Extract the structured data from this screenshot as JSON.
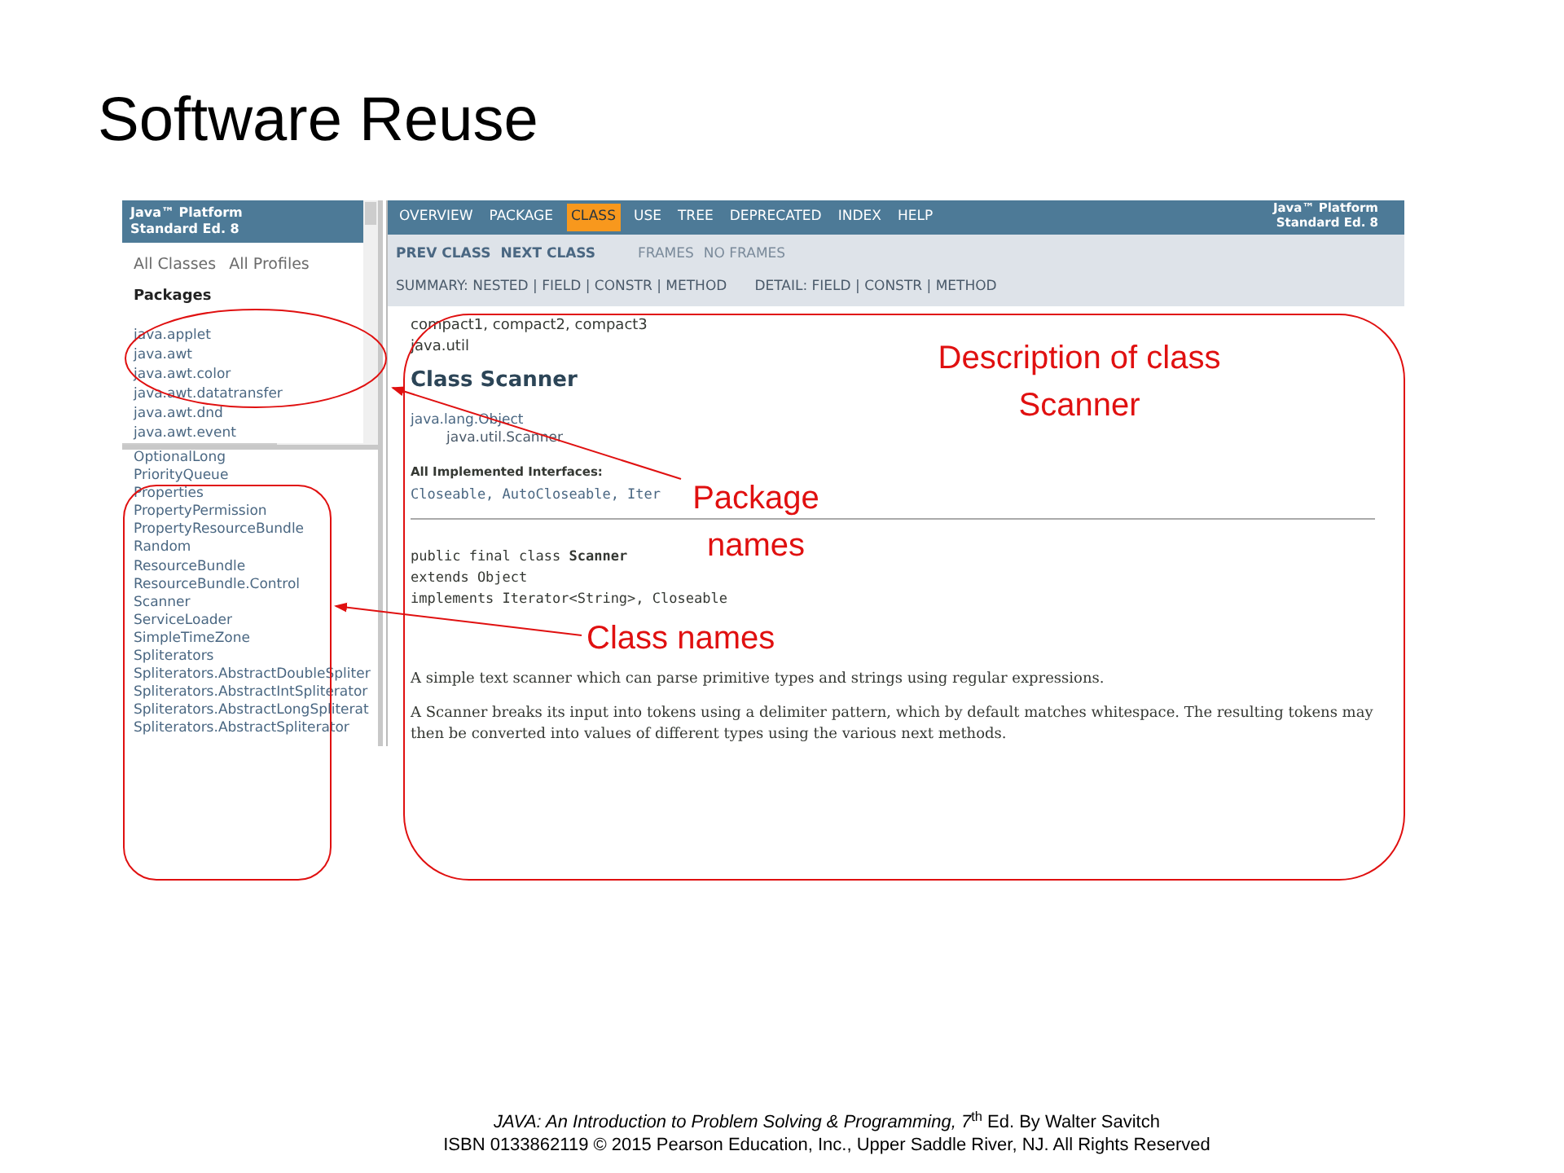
{
  "slide": {
    "title": "Software Reuse"
  },
  "left_frame": {
    "header_lines": [
      "Java™ Platform",
      "Standard Ed. 8"
    ],
    "links": [
      "All Classes",
      "All Profiles"
    ],
    "packages_heading": "Packages",
    "packages": [
      "java.applet",
      "java.awt",
      "java.awt.color",
      "java.awt.datatransfer",
      "java.awt.dnd",
      "java.awt.event"
    ]
  },
  "class_list": [
    "OptionalLong",
    "PriorityQueue",
    "Properties",
    "PropertyPermission",
    "PropertyResourceBundle",
    "Random",
    "ResourceBundle",
    "ResourceBundle.Control",
    "Scanner",
    "ServiceLoader",
    "SimpleTimeZone",
    "Spliterators",
    "Spliterators.AbstractDoubleSpliter",
    "Spliterators.AbstractIntSpliterator",
    "Spliterators.AbstractLongSpliterat",
    "Spliterators.AbstractSpliterator"
  ],
  "nav": {
    "items": [
      {
        "label": "OVERVIEW",
        "selected": false
      },
      {
        "label": "PACKAGE",
        "selected": false
      },
      {
        "label": "CLASS",
        "selected": true
      },
      {
        "label": "USE",
        "selected": false
      },
      {
        "label": "TREE",
        "selected": false
      },
      {
        "label": "DEPRECATED",
        "selected": false
      },
      {
        "label": "INDEX",
        "selected": false
      },
      {
        "label": "HELP",
        "selected": false
      }
    ],
    "header_lines": [
      "Java™ Platform",
      "Standard Ed. 8"
    ]
  },
  "subnav": {
    "prev": "PREV CLASS",
    "next": "NEXT CLASS",
    "frames": "FRAMES",
    "no_frames": "NO FRAMES",
    "summary": "SUMMARY: NESTED | FIELD | CONSTR | METHOD",
    "detail": "DETAIL: FIELD | CONSTR | METHOD"
  },
  "content": {
    "profiles": "compact1, compact2, compact3",
    "package": "java.util",
    "title": "Class Scanner",
    "hierarchy": [
      "java.lang.Object",
      "java.util.Scanner"
    ],
    "interfaces_heading": "All Implemented Interfaces:",
    "interfaces": "Closeable, AutoCloseable, Iter",
    "signature": [
      "public final class **Scanner**",
      "extends Object",
      "implements Iterator<String>, Closeable"
    ],
    "description": [
      "A simple text scanner which can parse primitive types and strings using regular expressions.",
      "A Scanner breaks its input into tokens using a delimiter pattern, which by default matches whitespace. The resulting tokens may then be converted into values of different types using the various next methods."
    ]
  },
  "annotations": [
    {
      "kind": "description",
      "lines": [
        "Description of class",
        "Scanner"
      ]
    },
    {
      "kind": "packages",
      "lines": [
        "Package",
        "names"
      ]
    },
    {
      "kind": "classes",
      "lines": [
        "Class names"
      ]
    }
  ],
  "footer": [
    "*JAVA: An Introduction to Problem Solving & Programming, 7*$^{th}$ Ed. By Walter Savitch",
    "ISBN 0133862119 © 2015 Pearson Education, Inc., Upper Saddle River, NJ. All Rights Reserved"
  ]
}
